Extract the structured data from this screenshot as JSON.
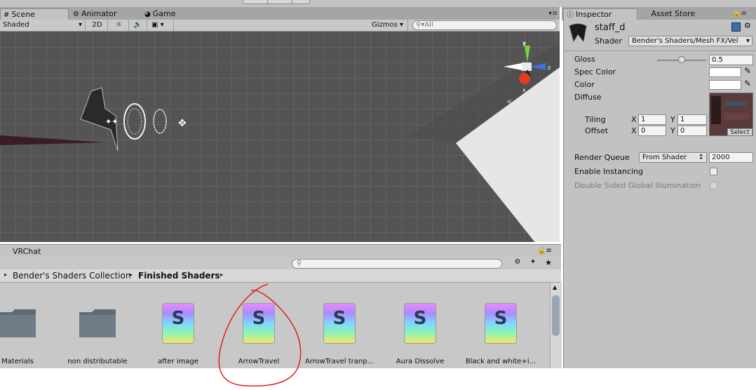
{
  "top_tabs_left": [
    {
      "label": "Scene",
      "icon": "grid-icon"
    },
    {
      "label": "Animator",
      "icon": "animator-icon"
    },
    {
      "label": "Game",
      "icon": "game-icon"
    }
  ],
  "top_tabs_right": [
    {
      "label": "Inspector",
      "icon": "info-icon"
    },
    {
      "label": "Asset Store",
      "icon": "store-icon"
    }
  ],
  "scene_toolbar": {
    "shading_mode": "Shaded",
    "mode_2d": "2D",
    "gizmos_label": "Gizmos",
    "search_placeholder": "All"
  },
  "gizmo_axes": {
    "y": "y",
    "x": "x",
    "z": "z"
  },
  "project": {
    "header_title": "VRChat",
    "breadcrumb": [
      {
        "label": "Bender's Shaders Collection",
        "bold": false
      },
      {
        "label": "Finished Shaders",
        "bold": true
      }
    ],
    "assets": [
      {
        "label": "Materials",
        "type": "folder"
      },
      {
        "label": "non distributable",
        "type": "folder"
      },
      {
        "label": "after image",
        "type": "shader"
      },
      {
        "label": "ArrowTravel",
        "type": "shader"
      },
      {
        "label": "ArrowTravel tranp...",
        "type": "shader"
      },
      {
        "label": "Aura Dissolve",
        "type": "shader"
      },
      {
        "label": "Black and white+i...",
        "type": "shader"
      }
    ],
    "shader_glyph": "S"
  },
  "inspector": {
    "material_name": "staff_d",
    "shader_label": "Shader",
    "shader_value": "Bender's Shaders/Mesh FX/Vel",
    "gloss_label": "Gloss",
    "gloss_value": "0.5",
    "gloss_fraction": 0.5,
    "spec_color_label": "Spec Color",
    "color_label": "Color",
    "diffuse_label": "Diffuse",
    "tiling_label": "Tiling",
    "offset_label": "Offset",
    "tiling_x": "1",
    "tiling_y": "1",
    "offset_x": "0",
    "offset_y": "0",
    "axis_x": "X",
    "axis_y": "Y",
    "select_label": "Select",
    "render_queue_label": "Render Queue",
    "render_queue_mode": "From Shader",
    "render_queue_value": "2000",
    "enable_instancing_label": "Enable Instancing",
    "double_sided_gi_label": "Double Sided Global Illumination"
  },
  "colors": {
    "annotation_circle": "#e0201a",
    "gizmo_y": "#7bd23a",
    "gizmo_z": "#3f6fe0",
    "gizmo_x": "#e63a20"
  }
}
